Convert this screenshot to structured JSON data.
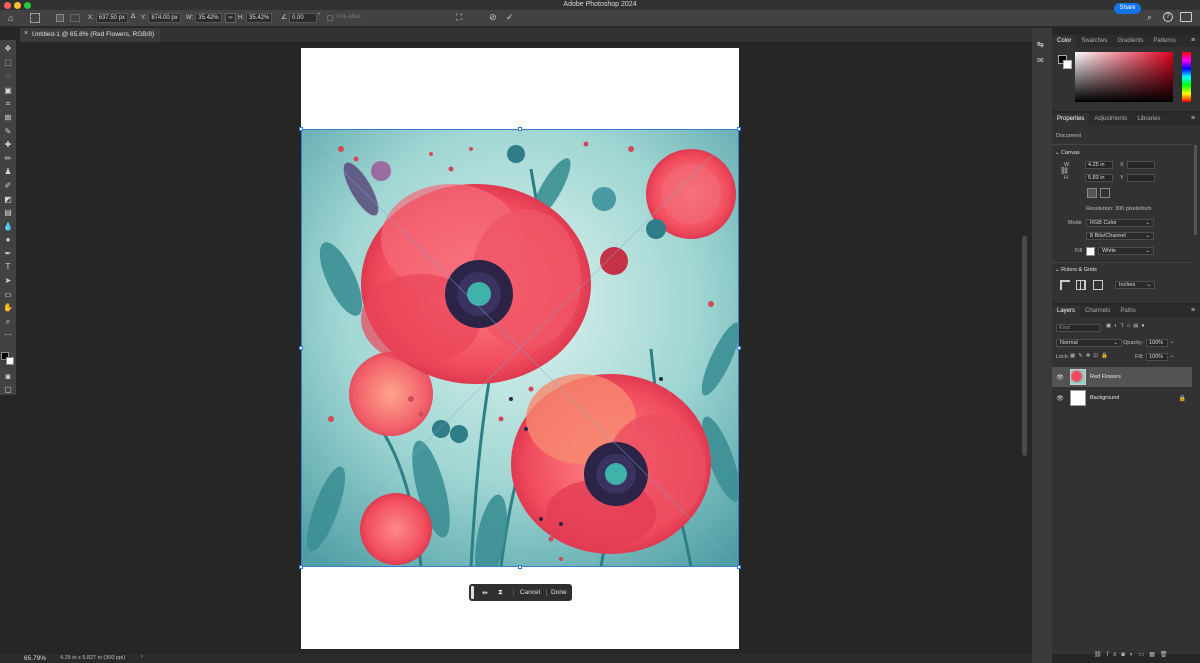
{
  "app": {
    "title": "Adobe Photoshop 2024",
    "share_label": "Share"
  },
  "options_bar": {
    "x_label": "X:",
    "x_value": "637.50 px",
    "y_label": "Y:",
    "y_value": "874.00 px",
    "w_label": "W:",
    "w_value": "35.42%",
    "h_label": "H:",
    "h_value": "35.42%",
    "angle_value": "0.00",
    "antialias_label": "Anti-alias"
  },
  "document": {
    "tab_title": "Untitled-1 @ 65.8% (Red Flowers, RGB/8)",
    "zoom": "65.79%",
    "status_info": "4.25 in x 5.827 in (300 ppi)"
  },
  "context_bar": {
    "cancel_label": "Cancel",
    "done_label": "Done"
  },
  "color_panel": {
    "tabs": [
      "Color",
      "Swatches",
      "Gradients",
      "Patterns"
    ],
    "active_tab": "Color",
    "hue_color": "#e0001e"
  },
  "properties_panel": {
    "tabs": [
      "Properties",
      "Adjustments",
      "Libraries"
    ],
    "doc_label": "Document",
    "canvas_section": "Canvas",
    "w_label": "W",
    "w_value": "4.25 in",
    "h_label": "H",
    "h_value": "5.83 in",
    "x_label": "X",
    "y_label": "Y",
    "resolution": "Resolution: 300 pixels/inch",
    "mode_label": "Mode",
    "mode_value": "RGB Color",
    "bits_value": "8 Bits/Channel",
    "fill_label": "Fill",
    "fill_value": "White",
    "rulers_section": "Rulers & Grids",
    "units_value": "Inches"
  },
  "layers_panel": {
    "tabs": [
      "Layers",
      "Channels",
      "Paths"
    ],
    "kind_placeholder": "Kind",
    "blend_mode": "Normal",
    "opacity_label": "Opacity:",
    "opacity_value": "100%",
    "lock_label": "Lock:",
    "fill_label": "Fill:",
    "fill_value": "100%",
    "layers": [
      {
        "name": "Red Flowers",
        "selected": true
      },
      {
        "name": "Background",
        "selected": false
      }
    ]
  }
}
